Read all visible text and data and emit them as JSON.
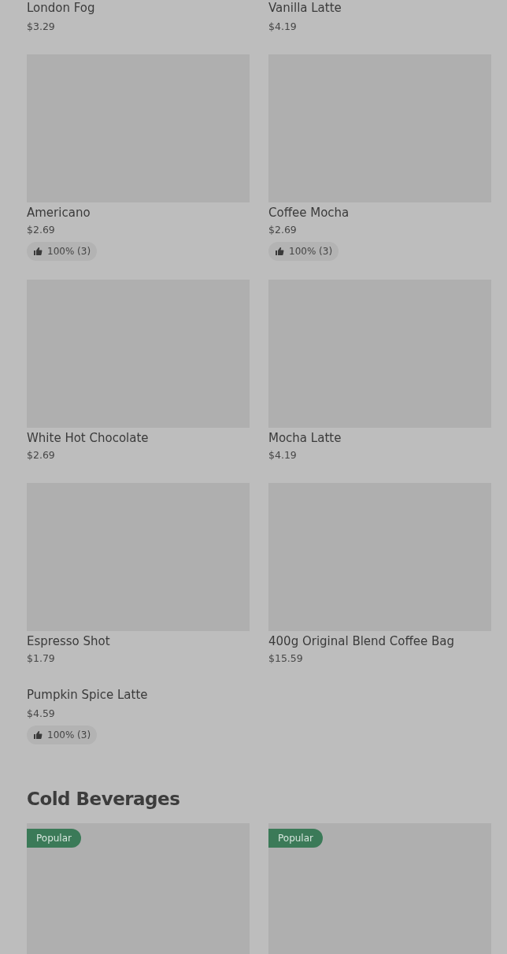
{
  "sections": [
    {
      "items": [
        {
          "name": "London Fog",
          "price": "$3.29",
          "image": false
        },
        {
          "name": "Vanilla Latte",
          "price": "$4.19",
          "image": false
        },
        {
          "name": "Americano",
          "price": "$2.69",
          "image": true,
          "rating": "100% (3)"
        },
        {
          "name": "Coffee Mocha",
          "price": "$2.69",
          "image": true,
          "rating": "100% (3)"
        },
        {
          "name": "White Hot Chocolate",
          "price": "$2.69",
          "image": true
        },
        {
          "name": "Mocha Latte",
          "price": "$4.19",
          "image": true
        },
        {
          "name": "Espresso Shot",
          "price": "$1.79",
          "image": true
        },
        {
          "name": "400g Original Blend Coffee Bag",
          "price": "$15.59",
          "image": true
        },
        {
          "name": "Pumpkin Spice Latte",
          "price": "$4.59",
          "image": false,
          "rating": "100% (3)"
        }
      ]
    },
    {
      "title": "Cold Beverages",
      "items": [
        {
          "badge": "Popular",
          "image": true
        },
        {
          "badge": "Popular",
          "image": true
        }
      ]
    }
  ]
}
